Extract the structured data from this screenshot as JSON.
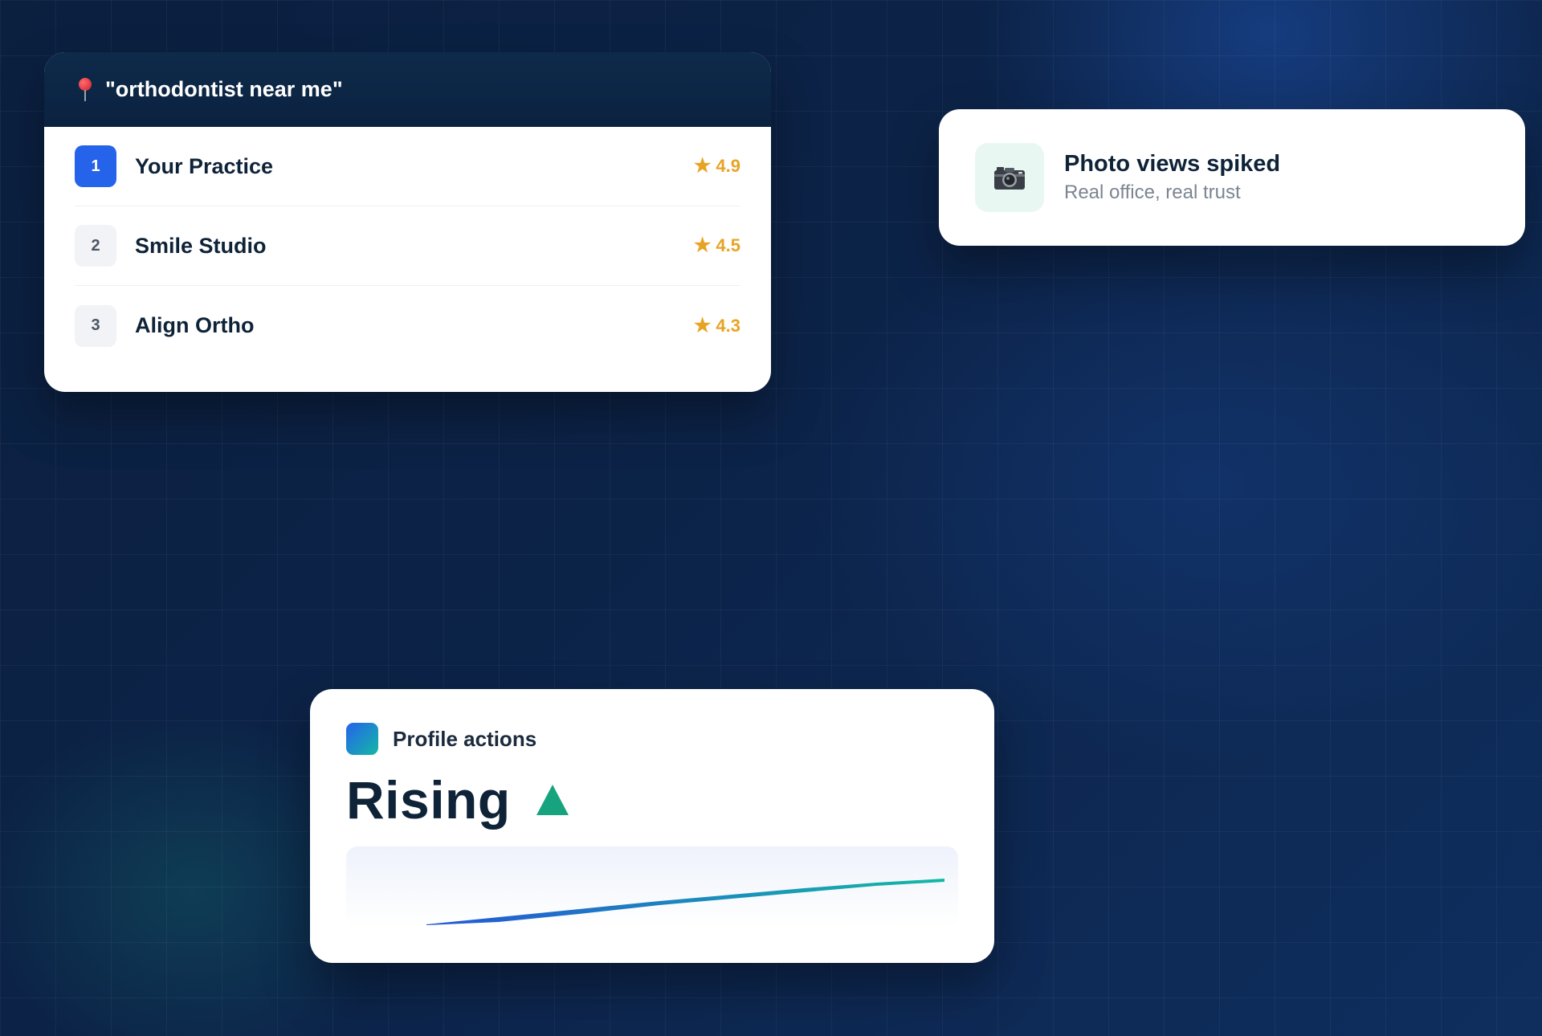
{
  "search_card": {
    "query": "\"orthodontist near me\"",
    "results": [
      {
        "rank": "1",
        "name": "Your Practice",
        "rating": "4.9"
      },
      {
        "rank": "2",
        "name": "Smile Studio",
        "rating": "4.5"
      },
      {
        "rank": "3",
        "name": "Align Ortho",
        "rating": "4.3"
      }
    ]
  },
  "notification": {
    "icon": "camera-icon",
    "title": "Photo views spiked",
    "subtitle": "Real office, real trust"
  },
  "profile_actions": {
    "label": "Profile actions",
    "status": "Rising",
    "trend_icon": "triangle-up-icon"
  },
  "colors": {
    "background": "#0c2348",
    "accent_blue": "#2563eb",
    "accent_teal": "#14b8a6",
    "rating_gold": "#e8a325",
    "trend_green": "#16a37e"
  },
  "icons": {
    "star": "★"
  }
}
